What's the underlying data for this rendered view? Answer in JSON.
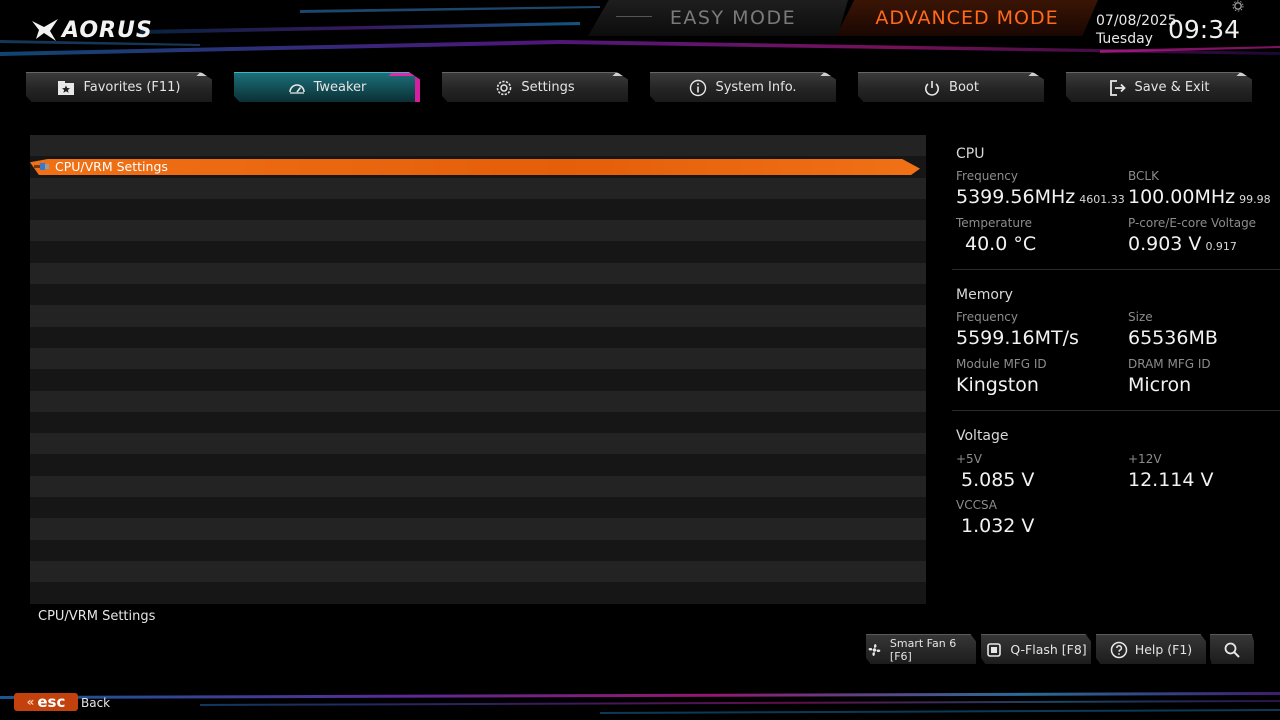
{
  "header": {
    "brand": "AORUS",
    "easy_mode": "EASY MODE",
    "advanced_mode": "ADVANCED MODE",
    "date": "07/08/2025",
    "weekday": "Tuesday",
    "time": "09:34"
  },
  "tabs": [
    {
      "label": "Favorites (F11)",
      "icon": "star-folder-icon"
    },
    {
      "label": "Tweaker",
      "icon": "gauge-icon"
    },
    {
      "label": "Settings",
      "icon": "gear-icon"
    },
    {
      "label": "System Info.",
      "icon": "info-icon"
    },
    {
      "label": "Boot",
      "icon": "power-icon"
    },
    {
      "label": "Save & Exit",
      "icon": "exit-icon"
    }
  ],
  "list": {
    "selected_item": "CPU/VRM Settings",
    "description": "CPU/VRM Settings"
  },
  "info": {
    "cpu": {
      "title": "CPU",
      "frequency_label": "Frequency",
      "frequency": "5399.56MHz",
      "frequency_sub": "4601.33",
      "bclk_label": "BCLK",
      "bclk": "100.00MHz",
      "bclk_sub": "99.98",
      "temp_label": "Temperature",
      "temp": "40.0 °C",
      "voltage_label": "P-core/E-core Voltage",
      "voltage": "0.903 V",
      "voltage_sub": "0.917"
    },
    "memory": {
      "title": "Memory",
      "frequency_label": "Frequency",
      "frequency": "5599.16MT/s",
      "size_label": "Size",
      "size": "65536MB",
      "module_label": "Module MFG ID",
      "module": "Kingston",
      "dram_label": "DRAM MFG ID",
      "dram": "Micron"
    },
    "voltage": {
      "title": "Voltage",
      "v5_label": "+5V",
      "v5": "5.085 V",
      "v12_label": "+12V",
      "v12": "12.114 V",
      "vccsa_label": "VCCSA",
      "vccsa": "1.032 V"
    }
  },
  "bottom": {
    "smart_fan": "Smart Fan 6 [F6]",
    "qflash": "Q-Flash [F8]",
    "help": "Help (F1)",
    "esc": "esc",
    "back": "Back"
  },
  "colors": {
    "accent_orange": "#f07116",
    "active_tab_teal": "#1d6f7a",
    "active_tab_magenta": "#d61fa0"
  }
}
